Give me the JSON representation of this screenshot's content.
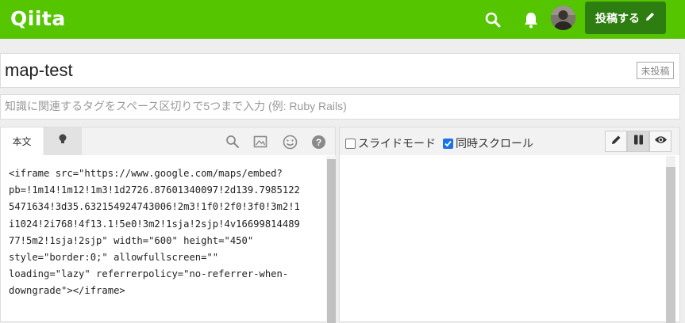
{
  "header": {
    "logo": "Qiita",
    "post_button_label": "投稿する",
    "brand_color": "#55c500"
  },
  "article": {
    "title": "map-test",
    "draft_badge": "未投稿",
    "tags_placeholder": "知識に関連するタグをスペース区切りで5つまで入力 (例: Ruby Rails)"
  },
  "editor": {
    "tabs": [
      {
        "label": "本文",
        "active": true
      },
      {
        "label": "",
        "icon": "lightbulb-icon",
        "active": false
      }
    ],
    "tools": [
      "search-icon",
      "image-icon",
      "smiley-icon",
      "help-icon"
    ],
    "content": "<iframe src=\"https://www.google.com/maps/embed?\npb=!1m14!1m12!1m3!1d2726.87601340097!2d139.7985122\n5471634!3d35.632154924743006!2m3!1f0!2f0!3f0!3m2!1\ni1024!2i768!4f13.1!5e0!3m2!1sja!2sjp!4v16699814489\n77!5m2!1sja!2sjp\" width=\"600\" height=\"450\"\nstyle=\"border:0;\" allowfullscreen=\"\"\nloading=\"lazy\" referrerpolicy=\"no-referrer-when-\ndowngrade\"></iframe>"
  },
  "preview": {
    "slide_mode_label": "スライドモード",
    "slide_mode_checked": false,
    "sync_scroll_label": "同時スクロール",
    "sync_scroll_checked": true,
    "modes": [
      "pencil-icon",
      "columns-icon",
      "eye-icon"
    ],
    "active_mode": "columns-icon"
  }
}
